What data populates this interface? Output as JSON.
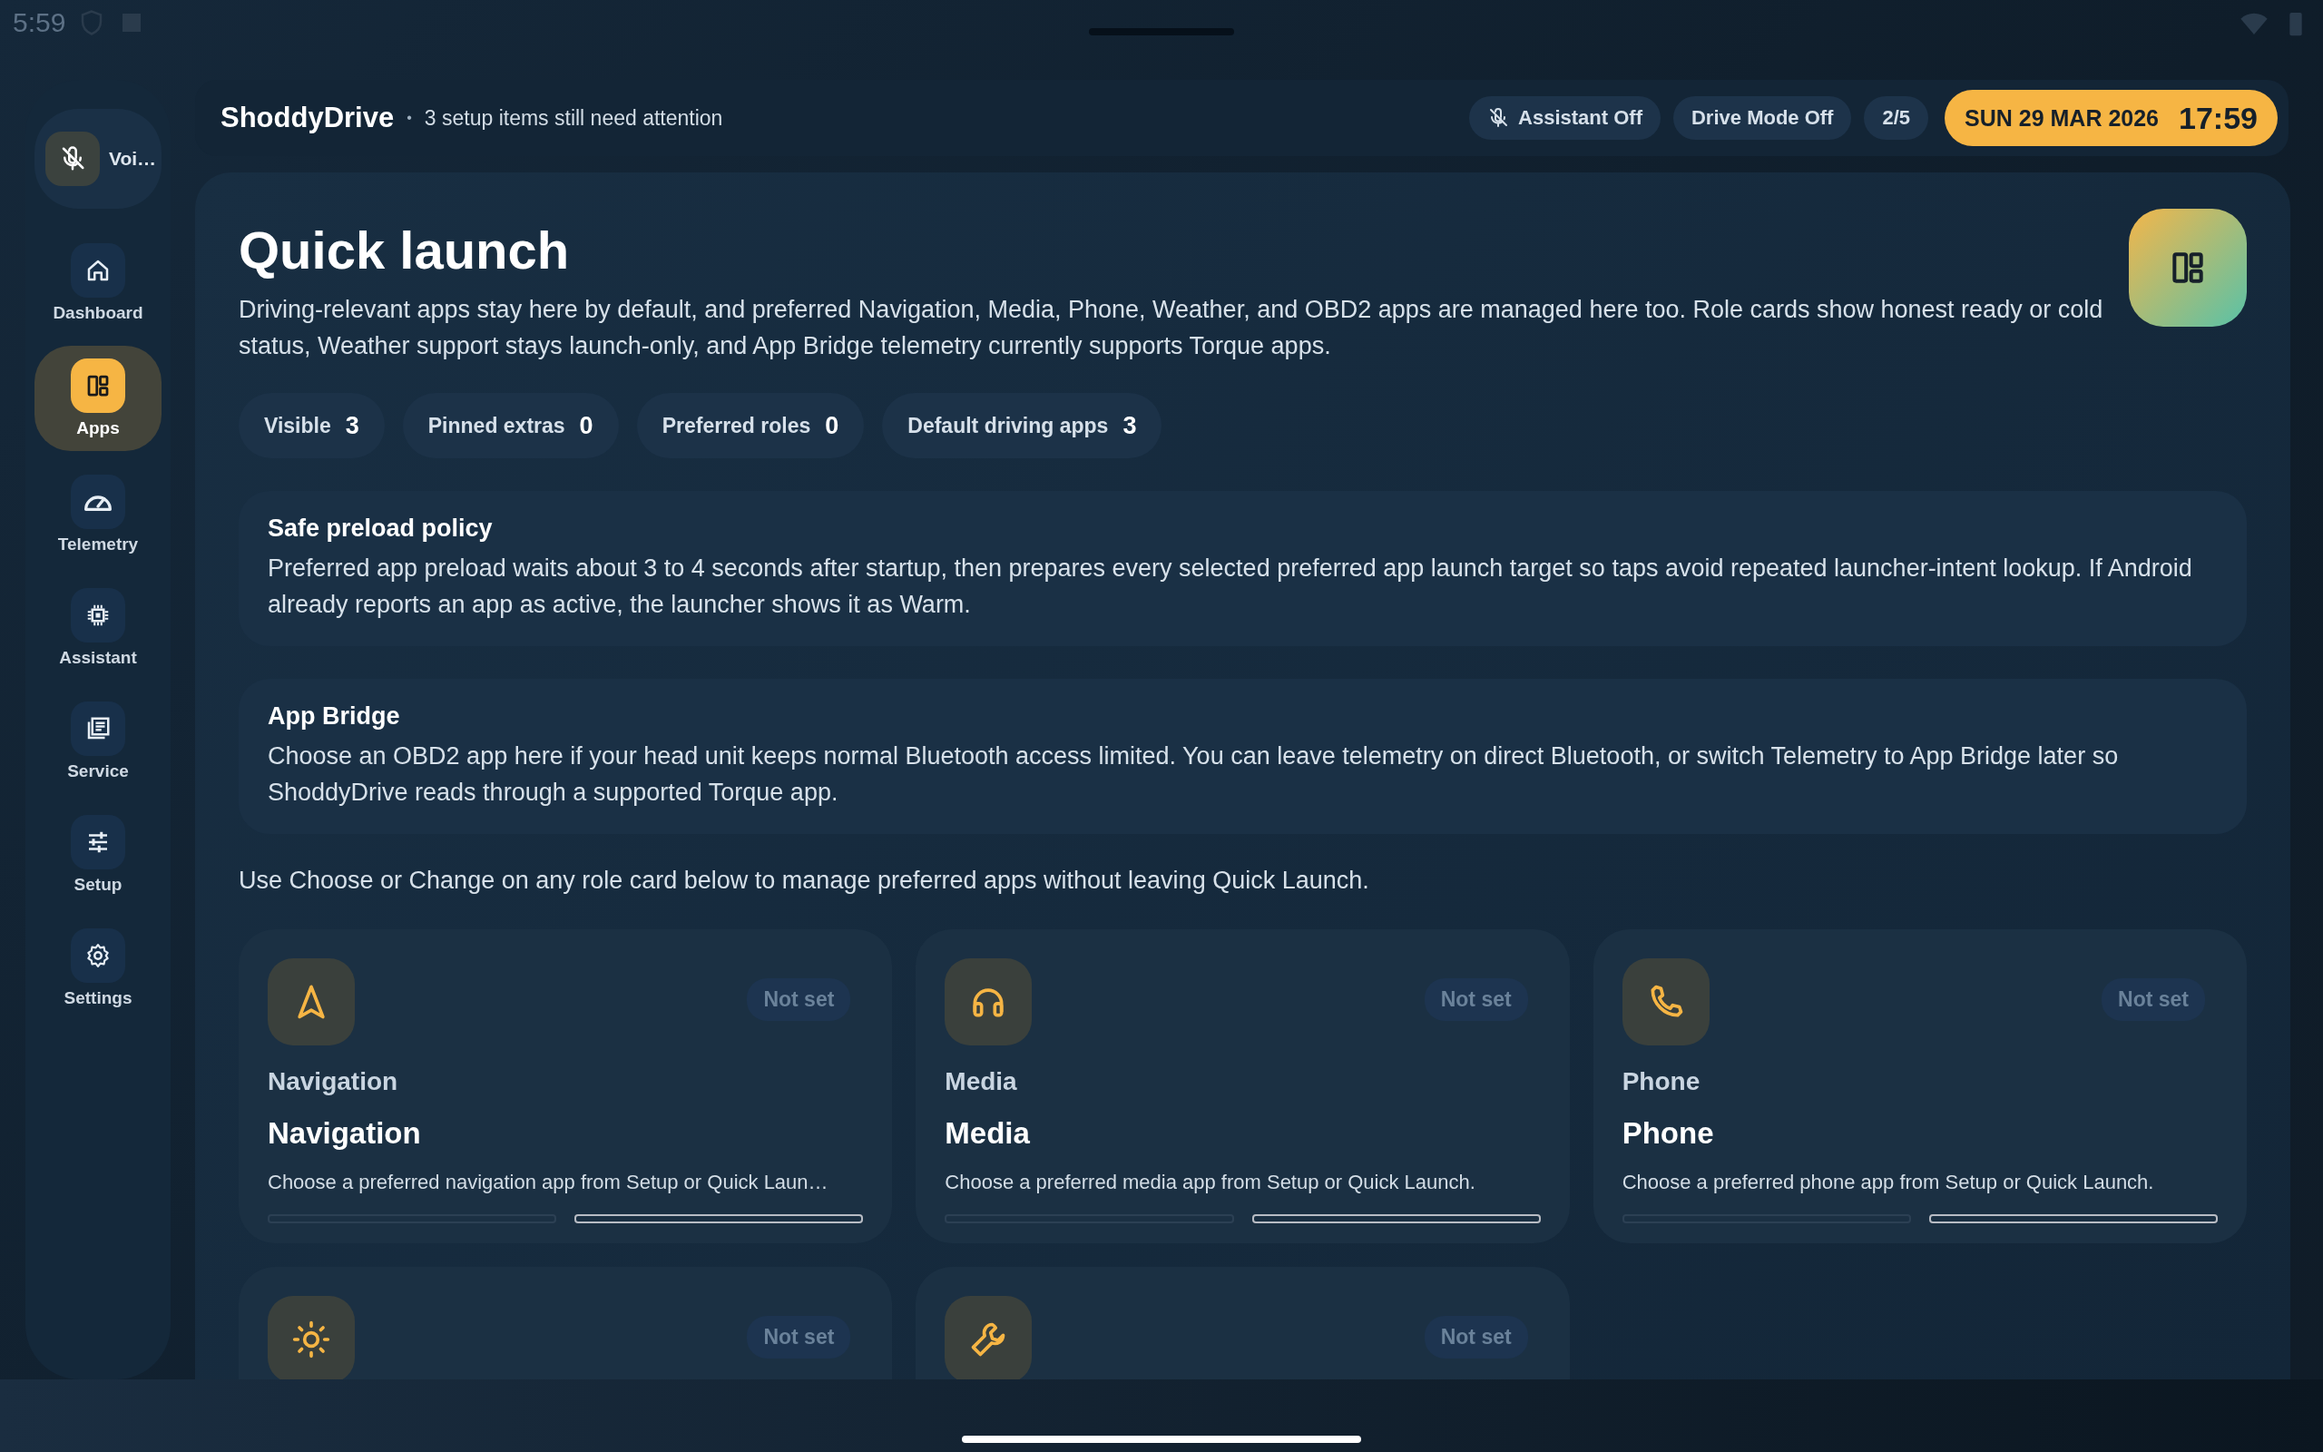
{
  "status_bar": {
    "time": "5:59"
  },
  "sidebar": {
    "voice": {
      "label": "Voi…"
    },
    "items": [
      {
        "label": "Dashboard",
        "selected": false
      },
      {
        "label": "Apps",
        "selected": true
      },
      {
        "label": "Telemetry",
        "selected": false
      },
      {
        "label": "Assistant",
        "selected": false
      },
      {
        "label": "Service",
        "selected": false
      },
      {
        "label": "Setup",
        "selected": false
      },
      {
        "label": "Settings",
        "selected": false
      }
    ]
  },
  "header": {
    "app_name": "ShoddyDrive",
    "separator": "•",
    "message": "3 setup items still need attention",
    "chips": [
      {
        "label": "Assistant Off",
        "kind": "mic-off"
      },
      {
        "label": "Drive Mode Off",
        "kind": "plain"
      },
      {
        "label": "2/5",
        "kind": "plain"
      }
    ],
    "date": "SUN 29 MAR 2026",
    "time": "17:59"
  },
  "main": {
    "title": "Quick launch",
    "description": "Driving-relevant apps stay here by default, and preferred Navigation, Media, Phone, Weather, and OBD2 apps are managed here too. Role cards show honest ready or cold status, Weather support stays launch-only, and App Bridge telemetry currently supports Torque apps.",
    "stats": [
      {
        "label": "Visible",
        "value": "3"
      },
      {
        "label": "Pinned extras",
        "value": "0"
      },
      {
        "label": "Preferred roles",
        "value": "0"
      },
      {
        "label": "Default driving apps",
        "value": "3"
      }
    ],
    "notices": [
      {
        "title": "Safe preload policy",
        "text": "Preferred app preload waits about 3 to 4 seconds after startup, then prepares every selected preferred app launch target so taps avoid repeated launcher-intent lookup. If Android already reports an app as active, the launcher shows it as Warm."
      },
      {
        "title": "App Bridge",
        "text": "Choose an OBD2 app here if your head unit keeps normal Bluetooth access limited. You can leave telemetry on direct Bluetooth, or switch Telemetry to App Bridge later so ShoddyDrive reads through a supported Torque app."
      }
    ],
    "hint": "Use Choose or Change on any role card below to manage preferred apps without leaving Quick Launch.",
    "role_cards": [
      {
        "status": "Not set",
        "role": "Navigation",
        "title": "Navigation",
        "description": "Choose a preferred navigation app from Setup or Quick Laun…"
      },
      {
        "status": "Not set",
        "role": "Media",
        "title": "Media",
        "description": "Choose a preferred media app from Setup or Quick Launch."
      },
      {
        "status": "Not set",
        "role": "Phone",
        "title": "Phone",
        "description": "Choose a preferred phone app from Setup or Quick Launch."
      },
      {
        "status": "Not set"
      },
      {
        "status": "Not set"
      }
    ]
  }
}
